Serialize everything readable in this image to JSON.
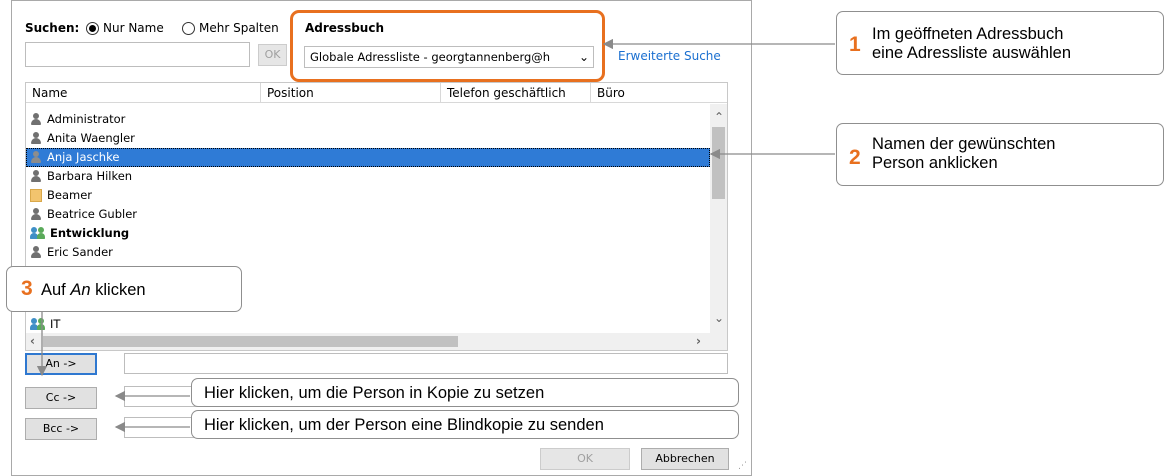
{
  "search": {
    "label": "Suchen:",
    "option_name_only": "Nur Name",
    "option_more_columns": "Mehr Spalten",
    "query": "",
    "ok_label": "OK"
  },
  "addressbook": {
    "label": "Adressbuch",
    "selected": "Globale Adressliste - georgtannenberg@h",
    "advanced_search": "Erweiterte Suche"
  },
  "columns": [
    "Name",
    "Position",
    "Telefon geschäftlich",
    "Büro"
  ],
  "rows": [
    {
      "name": "Administrator",
      "icon": "person-icon"
    },
    {
      "name": "Anita Waengler",
      "icon": "person-icon"
    },
    {
      "name": "Anja Jaschke",
      "icon": "person-icon",
      "selected": true
    },
    {
      "name": "Barbara Hilken",
      "icon": "person-icon"
    },
    {
      "name": "Beamer",
      "icon": "room-icon"
    },
    {
      "name": "Beatrice Gubler",
      "icon": "person-icon"
    },
    {
      "name": "Entwicklung",
      "icon": "group-icon",
      "bold": true
    },
    {
      "name": "Eric Sander",
      "icon": "person-icon"
    },
    {
      "name": "IT",
      "icon": "group-icon"
    }
  ],
  "recipients": {
    "to_label": "An ->",
    "to_value": "",
    "cc_label": "Cc ->",
    "cc_value": "",
    "bcc_label": "Bcc ->",
    "bcc_value": ""
  },
  "footer": {
    "ok_label": "OK",
    "cancel_label": "Abbrechen"
  },
  "callouts": {
    "c1_num": "1",
    "c1_line1": "Im geöffneten Adressbuch",
    "c1_line2": "eine Adressliste auswählen",
    "c2_num": "2",
    "c2_line1": "Namen der gewünschten",
    "c2_line2": "Person anklicken",
    "c3_num": "3",
    "c3_pre": "Auf ",
    "c3_em": "An",
    "c3_post": " klicken",
    "cc_text": "Hier klicken, um die Person in Kopie zu setzen",
    "bcc_text": "Hier klicken, um der Person eine Blindkopie zu senden"
  },
  "colors": {
    "highlight_orange": "#e8701f",
    "selection_blue": "#2f7bd6",
    "link_blue": "#1a6fd0"
  }
}
